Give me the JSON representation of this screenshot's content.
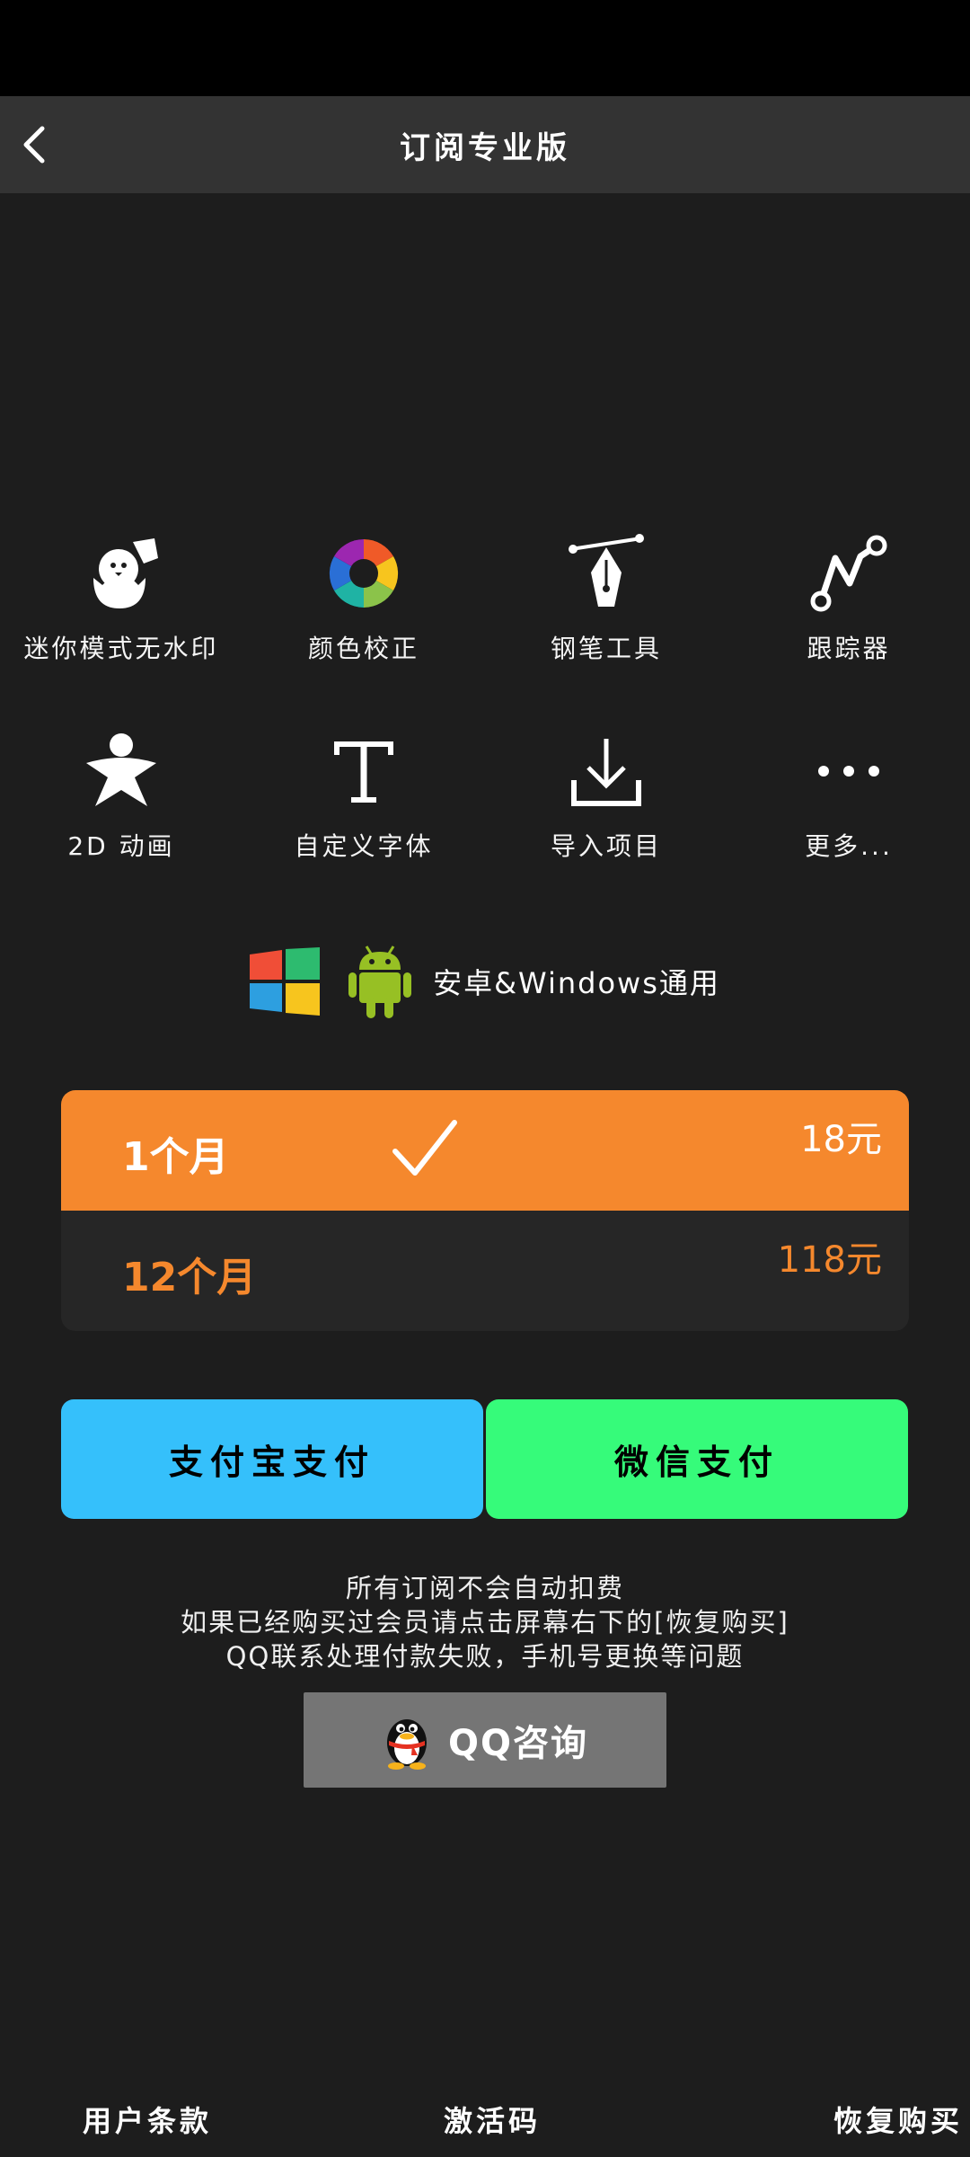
{
  "header": {
    "title": "订阅专业版"
  },
  "features": [
    {
      "icon": "chick-egg-icon",
      "label": "迷你模式无水印"
    },
    {
      "icon": "color-wheel-icon",
      "label": "颜色校正"
    },
    {
      "icon": "pen-tool-icon",
      "label": "钢笔工具"
    },
    {
      "icon": "tracker-icon",
      "label": "跟踪器"
    },
    {
      "icon": "2d-figure-icon",
      "label": "2D 动画"
    },
    {
      "icon": "font-t-icon",
      "label": "自定义字体"
    },
    {
      "icon": "import-download-icon",
      "label": "导入项目"
    },
    {
      "icon": "more-dots-icon",
      "label": "更多..."
    }
  ],
  "compat": {
    "text": "安卓&Windows通用"
  },
  "plans": [
    {
      "name": "1个月",
      "price": "18元",
      "selected": true
    },
    {
      "name": "12个月",
      "price": "118元",
      "selected": false
    }
  ],
  "payment": {
    "alipay": "支付宝支付",
    "wechat": "微信支付"
  },
  "notes": [
    "所有订阅不会自动扣费",
    "如果已经购买过会员请点击屏幕右下的[恢复购买]",
    "QQ联系处理付款失败，手机号更换等问题"
  ],
  "qq_button": {
    "label": "QQ咨询"
  },
  "footer": {
    "terms": "用户条款",
    "activation": "激活码",
    "restore": "恢复购买"
  },
  "colors": {
    "accent": "#f5882d",
    "alipay": "#35c0fb",
    "wechat": "#36fb7a",
    "background": "#1d1d1d"
  }
}
